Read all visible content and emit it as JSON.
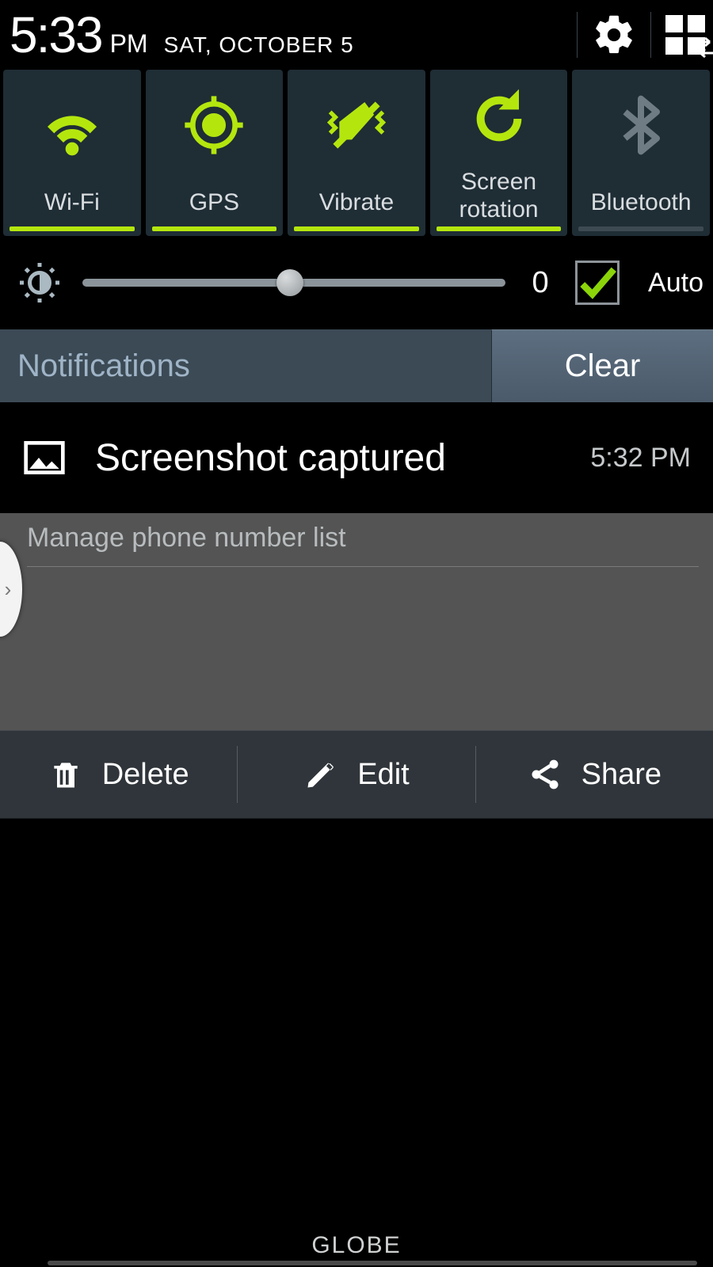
{
  "header": {
    "time": "5:33",
    "ampm": "PM",
    "date": "SAT, OCTOBER 5"
  },
  "quick_toggles": [
    {
      "label": "Wi-Fi",
      "active": true
    },
    {
      "label": "GPS",
      "active": true
    },
    {
      "label": "Vibrate",
      "active": true
    },
    {
      "label": "Screen rotation",
      "active": true
    },
    {
      "label": "Bluetooth",
      "active": false
    }
  ],
  "brightness": {
    "value": "0",
    "auto_label": "Auto",
    "auto_checked": true
  },
  "notifications_header": {
    "title": "Notifications",
    "clear": "Clear"
  },
  "notification": {
    "title": "Screenshot captured",
    "time": "5:32 PM"
  },
  "ongoing": {
    "subtitle": "Manage phone number list"
  },
  "actions": {
    "delete": "Delete",
    "edit": "Edit",
    "share": "Share"
  },
  "carrier": "GLOBE"
}
